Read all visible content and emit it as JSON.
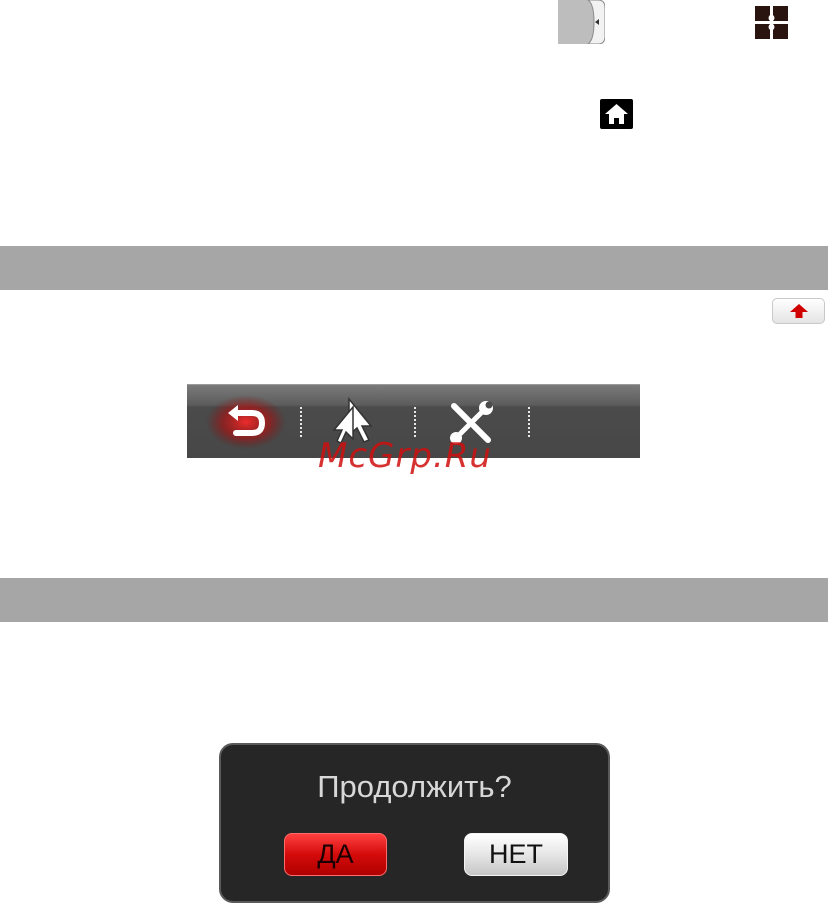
{
  "icons": {
    "panel_tab": "panel-tab-icon",
    "grid": "grid-icon",
    "home": "home-icon",
    "up": "up-arrow-icon",
    "back": "back-arrow-icon",
    "pointer": "pointer-icon",
    "tools": "tools-icon"
  },
  "watermark": "McGrp.Ru",
  "dialog": {
    "title": "Продолжить?",
    "yes_label": "ДА",
    "no_label": "НЕТ"
  },
  "colors": {
    "accent": "#d40b0b",
    "section_bar": "#a6a6a6",
    "dialog_bg": "#262626"
  }
}
